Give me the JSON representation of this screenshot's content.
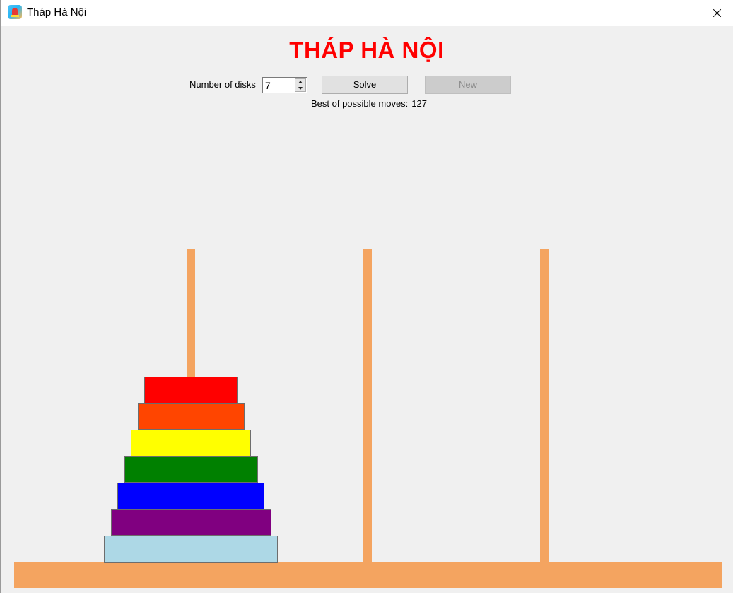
{
  "window": {
    "title": "Tháp Hà Nội",
    "icon": "hanoi-tower-app-icon"
  },
  "heading": "THÁP HÀ NỘI",
  "controls": {
    "disks_label": "Number of disks",
    "disks_value": "7",
    "solve_label": "Solve",
    "new_label": "New",
    "new_enabled": false
  },
  "moves": {
    "label": "Best of possible moves:",
    "value": "127"
  },
  "colors": {
    "heading": "#ff0000",
    "peg": "#f4a460",
    "base": "#f4a460",
    "background": "#f0f0f0"
  },
  "game": {
    "pegs": 3,
    "disks_on_peg": [
      [
        {
          "size": 7,
          "color": "#add8e6"
        },
        {
          "size": 6,
          "color": "#800080"
        },
        {
          "size": 5,
          "color": "#0000ff"
        },
        {
          "size": 4,
          "color": "#008000"
        },
        {
          "size": 3,
          "color": "#ffff00"
        },
        {
          "size": 2,
          "color": "#ff4500"
        },
        {
          "size": 1,
          "color": "#ff0000"
        }
      ],
      [],
      []
    ]
  }
}
